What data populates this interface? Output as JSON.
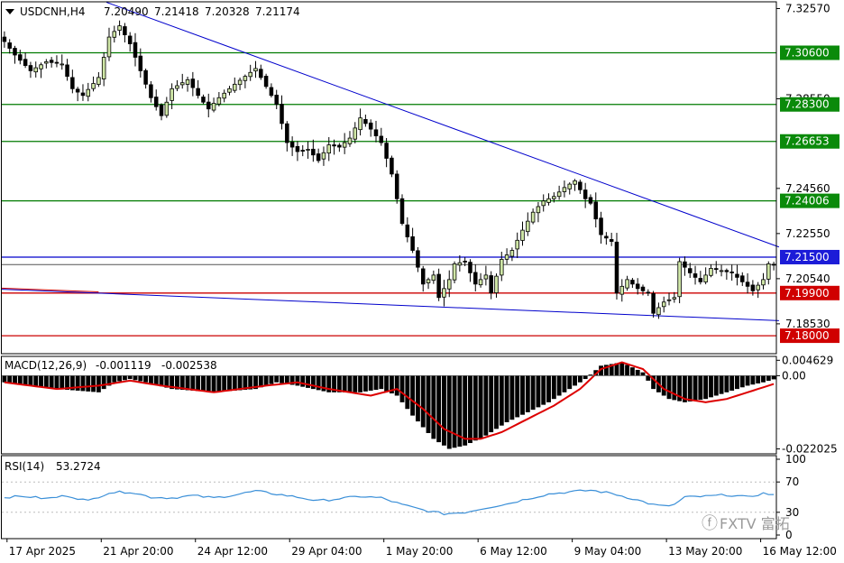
{
  "colors": {
    "background": "#ffffff",
    "candle": "#000000",
    "bull_body": "#cfe6a6",
    "trendline": "#0000cc",
    "support_red": "#cc0000",
    "level_green": "#007a00",
    "macd_signal": "#dd0000",
    "rsi_line": "#3a8fd8",
    "tag_green_bg": "#0a8a0a",
    "tag_red_bg": "#d00000",
    "tag_blue_bg": "#1c1cd8"
  },
  "watermark": {
    "glyph": "ⓕ",
    "text": "FXTV 富拓"
  },
  "chart_data": [
    {
      "type": "candlestick",
      "title": "USDCNH,H4",
      "ohlc_header": [
        "7.20490",
        "7.21418",
        "7.20328",
        "7.21174"
      ],
      "ylim": [
        7.172,
        7.3287
      ],
      "y_ticks": [
        "7.32570",
        "7.28550",
        "7.24560",
        "7.22550",
        "7.20540",
        "7.18530"
      ],
      "x_labels": [
        "17 Apr 2025",
        "21 Apr 20:00",
        "24 Apr 12:00",
        "29 Apr 04:00",
        "1 May 20:00",
        "6 May 12:00",
        "9 May 04:00",
        "13 May 20:00",
        "16 May 12:00"
      ],
      "x_label_index": [
        1,
        19,
        37,
        55,
        73,
        91,
        109,
        127,
        145
      ],
      "bar_count": 148,
      "close_anchors": [
        [
          0,
          7.311
        ],
        [
          2,
          7.305
        ],
        [
          5,
          7.298
        ],
        [
          8,
          7.302
        ],
        [
          11,
          7.301
        ],
        [
          13,
          7.29
        ],
        [
          15,
          7.287
        ],
        [
          18,
          7.295
        ],
        [
          20,
          7.313
        ],
        [
          22,
          7.318
        ],
        [
          24,
          7.31
        ],
        [
          26,
          7.298
        ],
        [
          28,
          7.286
        ],
        [
          30,
          7.278
        ],
        [
          32,
          7.29
        ],
        [
          35,
          7.294
        ],
        [
          37,
          7.287
        ],
        [
          39,
          7.281
        ],
        [
          41,
          7.286
        ],
        [
          44,
          7.292
        ],
        [
          48,
          7.299
        ],
        [
          50,
          7.291
        ],
        [
          52,
          7.283
        ],
        [
          54,
          7.266
        ],
        [
          56,
          7.262
        ],
        [
          58,
          7.263
        ],
        [
          60,
          7.258
        ],
        [
          62,
          7.265
        ],
        [
          64,
          7.264
        ],
        [
          66,
          7.268
        ],
        [
          68,
          7.277
        ],
        [
          70,
          7.272
        ],
        [
          72,
          7.266
        ],
        [
          74,
          7.252
        ],
        [
          76,
          7.23
        ],
        [
          78,
          7.218
        ],
        [
          80,
          7.203
        ],
        [
          82,
          7.207
        ],
        [
          83,
          7.197
        ],
        [
          85,
          7.205
        ],
        [
          86,
          7.212
        ],
        [
          88,
          7.213
        ],
        [
          90,
          7.203
        ],
        [
          92,
          7.207
        ],
        [
          93,
          7.199
        ],
        [
          95,
          7.214
        ],
        [
          97,
          7.218
        ],
        [
          99,
          7.227
        ],
        [
          101,
          7.235
        ],
        [
          103,
          7.24
        ],
        [
          105,
          7.242
        ],
        [
          107,
          7.246
        ],
        [
          109,
          7.249
        ],
        [
          111,
          7.241
        ],
        [
          112,
          7.239
        ],
        [
          114,
          7.225
        ],
        [
          116,
          7.222
        ],
        [
          117,
          7.199
        ],
        [
          119,
          7.205
        ],
        [
          121,
          7.201
        ],
        [
          123,
          7.199
        ],
        [
          124,
          7.19
        ],
        [
          126,
          7.195
        ],
        [
          128,
          7.197
        ],
        [
          129,
          7.213
        ],
        [
          131,
          7.208
        ],
        [
          133,
          7.204
        ],
        [
          135,
          7.21
        ],
        [
          137,
          7.209
        ],
        [
          139,
          7.208
        ],
        [
          141,
          7.204
        ],
        [
          143,
          7.2
        ],
        [
          145,
          7.205
        ],
        [
          146,
          7.212
        ],
        [
          147,
          7.2117
        ]
      ],
      "horizontal_levels": [
        {
          "value": 7.306,
          "label": "7.30600",
          "style": "green"
        },
        {
          "value": 7.283,
          "label": "7.28300",
          "style": "green"
        },
        {
          "value": 7.26653,
          "label": "7.26653",
          "style": "green"
        },
        {
          "value": 7.24006,
          "label": "7.24006",
          "style": "green"
        },
        {
          "value": 7.215,
          "label": "7.21500",
          "style": "blue"
        },
        {
          "value": 7.199,
          "label": "7.19900",
          "style": "red"
        },
        {
          "value": 7.18,
          "label": "7.18000",
          "style": "red"
        }
      ],
      "current_price_line": 7.2117,
      "trendlines": [
        {
          "from": [
            20,
            7.3285
          ],
          "to": [
            148,
            7.2195
          ],
          "color": "trendline"
        },
        {
          "from": [
            0,
            7.2007
          ],
          "to": [
            148,
            7.1867
          ],
          "color": "trendline"
        },
        {
          "from": [
            0,
            7.2012
          ],
          "to": [
            18,
            7.1995
          ],
          "color": "support_red"
        }
      ]
    },
    {
      "type": "bar",
      "title": "MACD(12,26,9)",
      "values_header": [
        "-0.001119",
        "-0.002538"
      ],
      "ylim": [
        -0.0235,
        0.0058
      ],
      "y_ticks": [
        "0.004629",
        "0.00",
        "-0.022025"
      ],
      "histogram_anchors": [
        [
          0,
          -0.002
        ],
        [
          10,
          -0.004
        ],
        [
          18,
          -0.005
        ],
        [
          21,
          -0.002
        ],
        [
          24,
          -0.001
        ],
        [
          27,
          -0.002
        ],
        [
          32,
          -0.004
        ],
        [
          40,
          -0.005
        ],
        [
          48,
          -0.004
        ],
        [
          52,
          -0.002
        ],
        [
          56,
          -0.003
        ],
        [
          62,
          -0.005
        ],
        [
          68,
          -0.005
        ],
        [
          72,
          -0.004
        ],
        [
          75,
          -0.006
        ],
        [
          78,
          -0.012
        ],
        [
          82,
          -0.019
        ],
        [
          85,
          -0.022
        ],
        [
          88,
          -0.021
        ],
        [
          92,
          -0.018
        ],
        [
          96,
          -0.014
        ],
        [
          100,
          -0.011
        ],
        [
          104,
          -0.008
        ],
        [
          108,
          -0.004
        ],
        [
          111,
          -0.001
        ],
        [
          114,
          0.003
        ],
        [
          118,
          0.004
        ],
        [
          122,
          0.001
        ],
        [
          124,
          -0.004
        ],
        [
          127,
          -0.007
        ],
        [
          130,
          -0.008
        ],
        [
          134,
          -0.007
        ],
        [
          138,
          -0.005
        ],
        [
          142,
          -0.003
        ],
        [
          145,
          -0.002
        ],
        [
          147,
          -0.0011
        ]
      ],
      "signal_anchors": [
        [
          0,
          -0.002
        ],
        [
          10,
          -0.004
        ],
        [
          18,
          -0.003
        ],
        [
          24,
          -0.0015
        ],
        [
          30,
          -0.003
        ],
        [
          40,
          -0.005
        ],
        [
          50,
          -0.003
        ],
        [
          56,
          -0.002
        ],
        [
          62,
          -0.004
        ],
        [
          70,
          -0.006
        ],
        [
          75,
          -0.004
        ],
        [
          80,
          -0.01
        ],
        [
          84,
          -0.016
        ],
        [
          88,
          -0.019
        ],
        [
          91,
          -0.019
        ],
        [
          95,
          -0.017
        ],
        [
          100,
          -0.013
        ],
        [
          105,
          -0.009
        ],
        [
          110,
          -0.004
        ],
        [
          114,
          0.002
        ],
        [
          118,
          0.004
        ],
        [
          122,
          0.002
        ],
        [
          126,
          -0.004
        ],
        [
          130,
          -0.007
        ],
        [
          134,
          -0.008
        ],
        [
          138,
          -0.007
        ],
        [
          142,
          -0.005
        ],
        [
          147,
          -0.0025
        ]
      ]
    },
    {
      "type": "line",
      "title": "RSI(14)",
      "value_header": "53.2724",
      "ylim": [
        0,
        100
      ],
      "y_ticks": [
        "100",
        "70",
        "30",
        "0"
      ],
      "levels": [
        70,
        30
      ],
      "rsi_anchors": [
        [
          0,
          50
        ],
        [
          4,
          51
        ],
        [
          8,
          48
        ],
        [
          12,
          52
        ],
        [
          16,
          45
        ],
        [
          20,
          56
        ],
        [
          24,
          57
        ],
        [
          28,
          50
        ],
        [
          32,
          49
        ],
        [
          36,
          52
        ],
        [
          40,
          49
        ],
        [
          44,
          53
        ],
        [
          48,
          58
        ],
        [
          52,
          54
        ],
        [
          56,
          50
        ],
        [
          60,
          45
        ],
        [
          64,
          48
        ],
        [
          68,
          51
        ],
        [
          72,
          49
        ],
        [
          76,
          40
        ],
        [
          80,
          33
        ],
        [
          84,
          28
        ],
        [
          88,
          30
        ],
        [
          92,
          36
        ],
        [
          96,
          41
        ],
        [
          100,
          48
        ],
        [
          104,
          54
        ],
        [
          108,
          57
        ],
        [
          112,
          59
        ],
        [
          116,
          55
        ],
        [
          120,
          48
        ],
        [
          124,
          40
        ],
        [
          126,
          38
        ],
        [
          128,
          40
        ],
        [
          130,
          50
        ],
        [
          134,
          51
        ],
        [
          138,
          53
        ],
        [
          142,
          50
        ],
        [
          145,
          55
        ],
        [
          147,
          53
        ]
      ]
    }
  ]
}
